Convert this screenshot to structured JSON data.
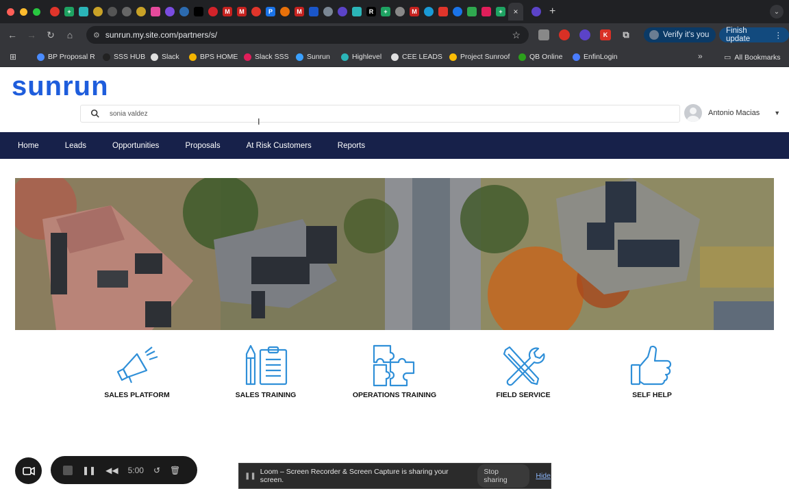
{
  "browser": {
    "tabs": {
      "active_close": "×",
      "new_tab": "+"
    },
    "toolbar": {
      "url": "sunrun.my.site.com/partners/s/",
      "verify_label": "Verify it's you",
      "finish_update_label": "Finish update"
    },
    "bookmarks": [
      {
        "label": "BP Proposal R",
        "color": "#4a8cff"
      },
      {
        "label": "SSS HUB",
        "color": "#222222"
      },
      {
        "label": "Slack",
        "color": "#e0e0e0"
      },
      {
        "label": "BPS HOME",
        "color": "#f3b400"
      },
      {
        "label": "Slack SSS",
        "color": "#e01e5a"
      },
      {
        "label": "Sunrun",
        "color": "#3aa0ff"
      },
      {
        "label": "Highlevel",
        "color": "#2bb5b8"
      },
      {
        "label": "CEE LEADS",
        "color": "#e0e0e0"
      },
      {
        "label": "Project Sunroof",
        "color": "#fbbc05"
      },
      {
        "label": "QB Online",
        "color": "#2ca01c"
      },
      {
        "label": "EnfinLogin",
        "color": "#4a7dff"
      }
    ],
    "all_bookmarks": "All Bookmarks"
  },
  "site": {
    "logo": "sunrun",
    "search": {
      "value": "sonia valdez"
    },
    "user": {
      "name": "Antonio Macias"
    },
    "nav": [
      "Home",
      "Leads",
      "Opportunities",
      "Proposals",
      "At Risk Customers",
      "Reports"
    ],
    "tiles": [
      {
        "label": "SALES PLATFORM",
        "icon": "megaphone-icon"
      },
      {
        "label": "SALES TRAINING",
        "icon": "pencil-clipboard-icon"
      },
      {
        "label": "OPERATIONS TRAINING",
        "icon": "puzzle-icon"
      },
      {
        "label": "FIELD SERVICE",
        "icon": "tools-icon"
      },
      {
        "label": "SELF HELP",
        "icon": "thumbs-up-icon"
      }
    ],
    "accent_color": "#1e5ddc",
    "nav_color": "#17214a",
    "icon_color": "#2f8fd8"
  },
  "loom": {
    "timer": "5:00",
    "share_message": "Loom – Screen Recorder & Screen Capture is sharing your screen.",
    "stop_sharing": "Stop sharing",
    "hide": "Hide"
  }
}
